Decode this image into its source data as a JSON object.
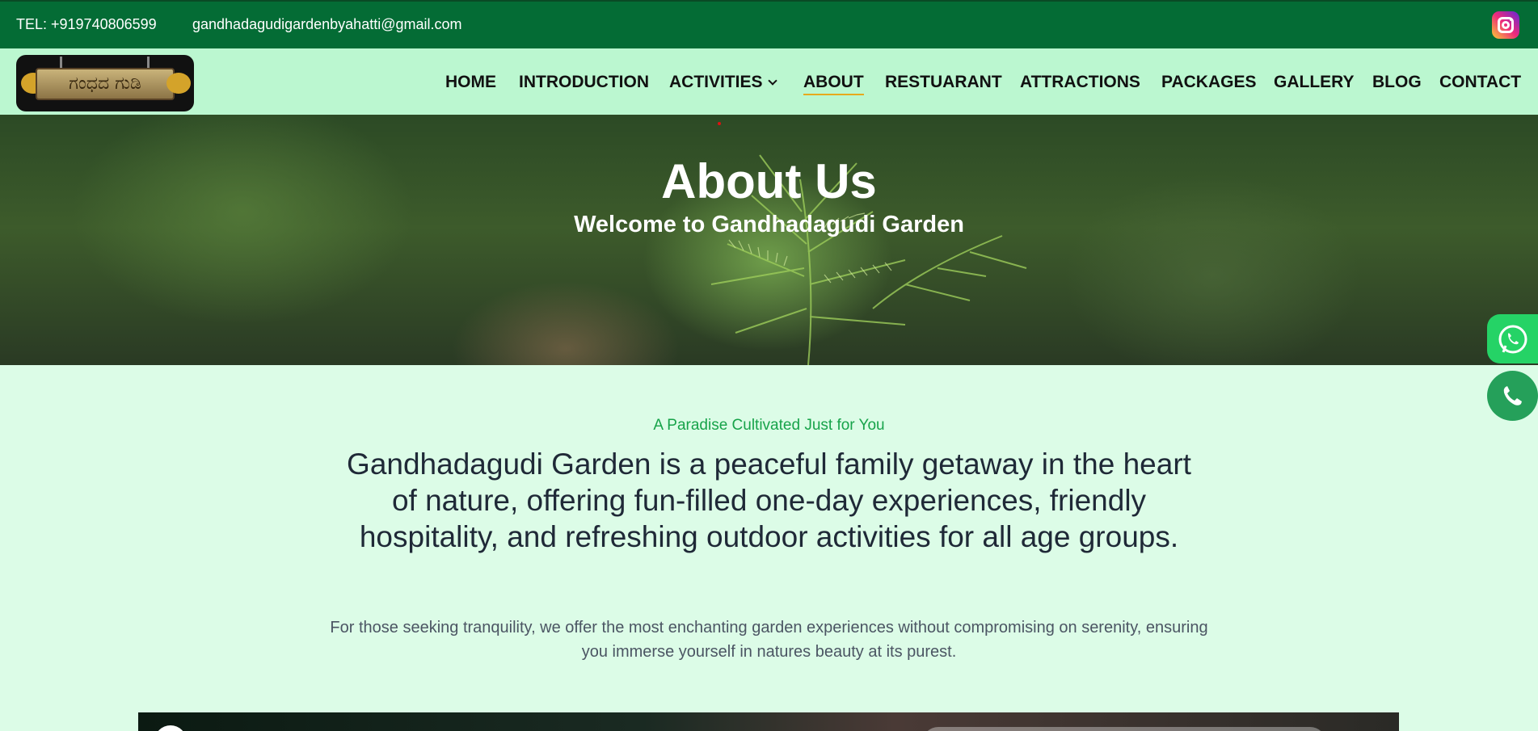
{
  "topbar": {
    "tel": "TEL: +919740806599",
    "email": "gandhadagudigardenbyahatti@gmail.com",
    "instagram_icon": "instagram-icon"
  },
  "logo": {
    "text": "ಗಂಧದ ಗುಡಿ",
    "icon": "logo-signboard"
  },
  "nav": {
    "items": [
      {
        "label": "HOME"
      },
      {
        "label": "INTRODUCTION"
      },
      {
        "label": "ACTIVITIES"
      },
      {
        "label": "ABOUT"
      },
      {
        "label": "RESTUARANT"
      },
      {
        "label": "ATTRACTIONS"
      },
      {
        "label": "PACKAGES"
      },
      {
        "label": "GALLERY"
      },
      {
        "label": "BLOG"
      },
      {
        "label": "CONTACT"
      }
    ],
    "active": "ABOUT"
  },
  "hero": {
    "title": "About Us",
    "subtitle": "Welcome to Gandhadagudi Garden"
  },
  "about": {
    "eyebrow": "A Paradise Cultivated Just for You",
    "lead": "Gandhadagudi Garden is a peaceful family getaway in the heart of nature, offering fun-filled one-day experiences, friendly hospitality, and refreshing outdoor activities for all age groups.",
    "body": "For those seeking tranquility, we offer the most enchanting garden experiences without compromising on serenity, ensuring you immerse yourself in natures beauty at its purest."
  },
  "floating": {
    "whatsapp_icon": "whatsapp-icon",
    "call_icon": "phone-icon"
  },
  "colors": {
    "topbar": "#046c35",
    "navbar": "#bbf7d0",
    "page_bg": "#dcfce7",
    "accent_green": "#17a34a",
    "active_underline": "#e6a91d"
  }
}
